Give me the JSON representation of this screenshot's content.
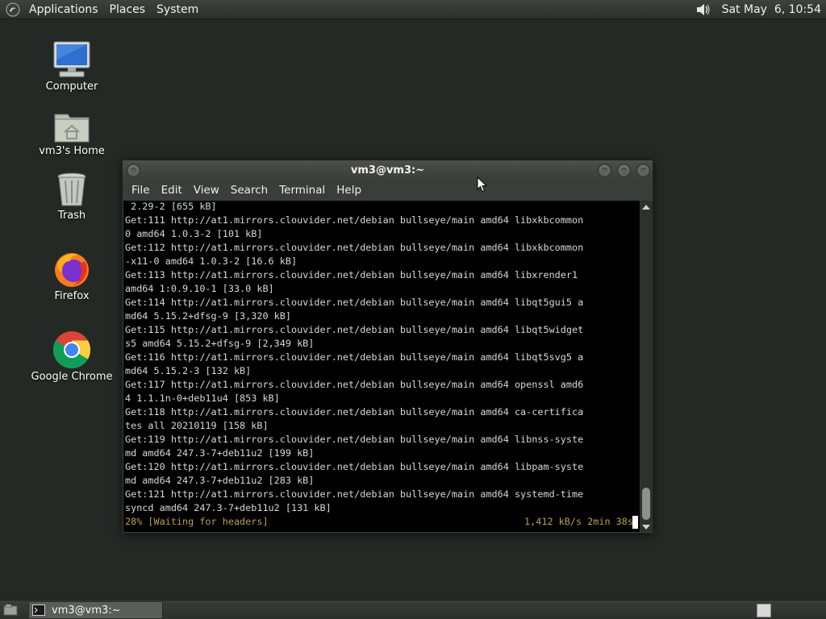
{
  "top_panel": {
    "menus": [
      "Applications",
      "Places",
      "System"
    ],
    "clock": "Sat May  6, 10:54",
    "icons": {
      "logo": "gnome-foot-icon",
      "volume": "speaker-volume-icon"
    }
  },
  "desktop_icons": [
    {
      "label": "Computer",
      "icon": "computer-icon"
    },
    {
      "label": "vm3's Home",
      "icon": "home-folder-icon"
    },
    {
      "label": "Trash",
      "icon": "trash-icon"
    },
    {
      "label": "Firefox",
      "icon": "firefox-icon"
    },
    {
      "label": "Google Chrome",
      "icon": "chrome-icon"
    }
  ],
  "terminal": {
    "title": "vm3@vm3:~",
    "menu": [
      "File",
      "Edit",
      "View",
      "Search",
      "Terminal",
      "Help"
    ],
    "lines": [
      " 2.29-2 [655 kB]",
      "Get:111 http://at1.mirrors.clouvider.net/debian bullseye/main amd64 libxkbcommon",
      "0 amd64 1.0.3-2 [101 kB]",
      "Get:112 http://at1.mirrors.clouvider.net/debian bullseye/main amd64 libxkbcommon",
      "-x11-0 amd64 1.0.3-2 [16.6 kB]",
      "Get:113 http://at1.mirrors.clouvider.net/debian bullseye/main amd64 libxrender1",
      "amd64 1:0.9.10-1 [33.0 kB]",
      "Get:114 http://at1.mirrors.clouvider.net/debian bullseye/main amd64 libqt5gui5 a",
      "md64 5.15.2+dfsg-9 [3,320 kB]",
      "Get:115 http://at1.mirrors.clouvider.net/debian bullseye/main amd64 libqt5widget",
      "s5 amd64 5.15.2+dfsg-9 [2,349 kB]",
      "Get:116 http://at1.mirrors.clouvider.net/debian bullseye/main amd64 libqt5svg5 a",
      "md64 5.15.2-3 [132 kB]",
      "Get:117 http://at1.mirrors.clouvider.net/debian bullseye/main amd64 openssl amd6",
      "4 1.1.1n-0+deb11u4 [853 kB]",
      "Get:118 http://at1.mirrors.clouvider.net/debian bullseye/main amd64 ca-certifica",
      "tes all 20210119 [158 kB]",
      "Get:119 http://at1.mirrors.clouvider.net/debian bullseye/main amd64 libnss-syste",
      "md amd64 247.3-7+deb11u2 [199 kB]",
      "Get:120 http://at1.mirrors.clouvider.net/debian bullseye/main amd64 libpam-syste",
      "md amd64 247.3-7+deb11u2 [283 kB]",
      "Get:121 http://at1.mirrors.clouvider.net/debian bullseye/main amd64 systemd-time",
      "syncd amd64 247.3-7+deb11u2 [131 kB]"
    ],
    "status_left": "28% [Waiting for headers]",
    "status_right": "1,412 kB/s 2min 38s",
    "status_color": "#b8a050"
  },
  "bottom_panel": {
    "task_label": "vm3@vm3:~",
    "icons": {
      "show_desktop": "show-desktop-icon",
      "task": "terminal-icon",
      "workspace": "workspace-switcher-icon"
    }
  },
  "colors": {
    "desktop_bg": "#252925",
    "terminal_bg": "#000000",
    "terminal_fg": "#d8d8d8"
  }
}
